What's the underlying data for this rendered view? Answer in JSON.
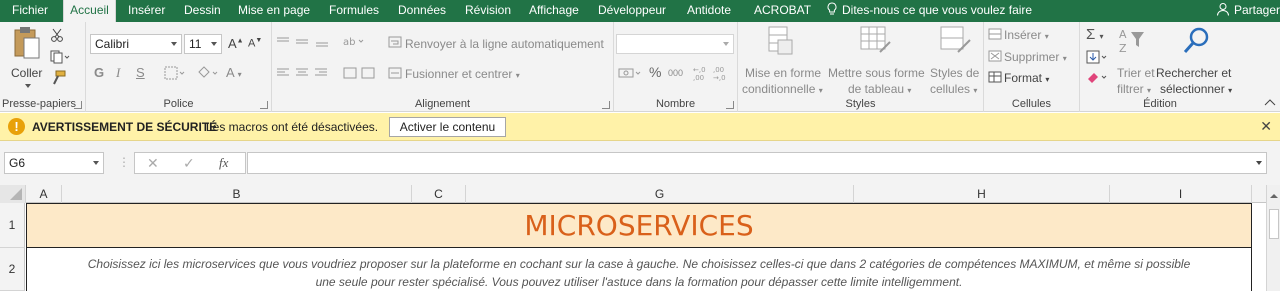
{
  "menu": {
    "tabs": [
      {
        "label": "Fichier"
      },
      {
        "label": "Accueil"
      },
      {
        "label": "Insérer"
      },
      {
        "label": "Dessin"
      },
      {
        "label": "Mise en page"
      },
      {
        "label": "Formules"
      },
      {
        "label": "Données"
      },
      {
        "label": "Révision"
      },
      {
        "label": "Affichage"
      },
      {
        "label": "Développeur"
      },
      {
        "label": "Antidote"
      },
      {
        "label": "ACROBAT"
      }
    ],
    "tell_me": "Dites-nous ce que vous voulez faire",
    "share": "Partager",
    "accent": "#217346"
  },
  "ribbon": {
    "clipboard": {
      "paste": "Coller",
      "label": "Presse-papiers"
    },
    "font": {
      "name": "Calibri",
      "size": "11",
      "bold": "G",
      "italic": "I",
      "underline": "S",
      "label": "Police"
    },
    "alignment": {
      "wrap": "Renvoyer à la ligne automatiquement",
      "merge": "Fusionner et centrer",
      "label": "Alignement"
    },
    "number": {
      "percent": "%",
      "thousands": "000",
      "label": "Nombre"
    },
    "styles": {
      "conditional_1": "Mise en forme",
      "conditional_2": "conditionnelle",
      "table_1": "Mettre sous forme",
      "table_2": "de tableau",
      "cell_1": "Styles de",
      "cell_2": "cellules",
      "label": "Styles"
    },
    "cells": {
      "insert": "Insérer",
      "delete": "Supprimer",
      "format": "Format",
      "label": "Cellules"
    },
    "editing": {
      "sort_1": "Trier et",
      "sort_2": "filtrer",
      "find_1": "Rechercher et",
      "find_2": "sélectionner",
      "label": "Édition"
    }
  },
  "security": {
    "title": "AVERTISSEMENT DE SÉCURITÉ",
    "message": "Les macros ont été désactivées.",
    "button": "Activer le contenu"
  },
  "formula_bar": {
    "name_box": "G6",
    "fx": "fx",
    "value": ""
  },
  "grid": {
    "columns": [
      "A",
      "B",
      "C",
      "G",
      "H",
      "I"
    ],
    "rows": [
      "1",
      "2"
    ],
    "title": "MICROSERVICES",
    "description_line1": "Choisissez ici les microservices que vous voudriez proposer sur la plateforme en cochant sur la case à gauche. Ne choisissez celles-ci que dans 2 catégories de compétences MAXIMUM, et même si possible",
    "description_line2": "une seule pour rester spécialisé. Vous pouvez utiliser l'astuce dans la formation pour dépasser cette limite intelligemment.",
    "title_color": "#d9601a",
    "title_fill": "#fde9c8"
  }
}
